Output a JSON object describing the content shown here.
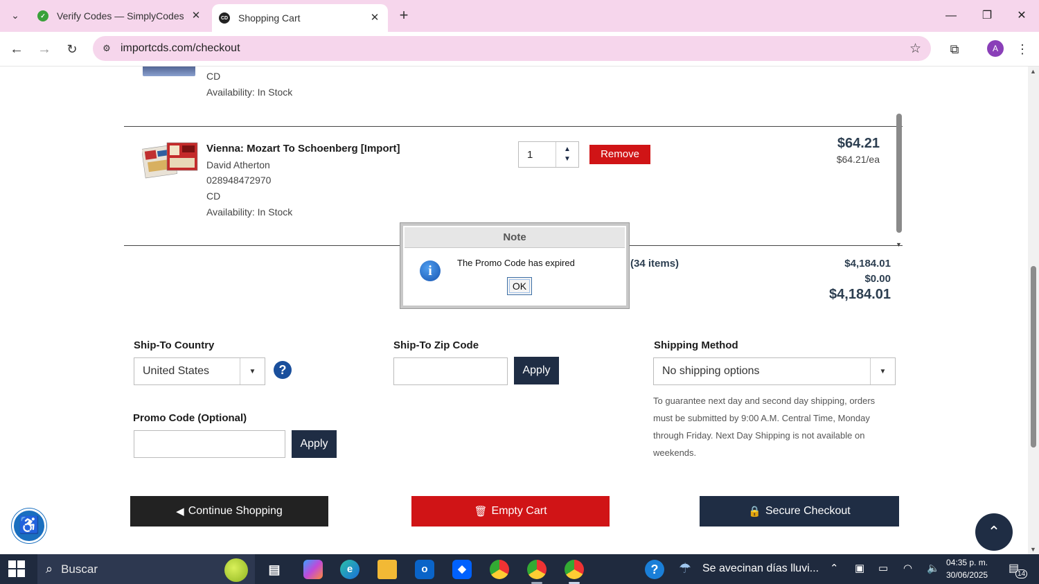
{
  "browser": {
    "tabs": [
      {
        "title": "Verify Codes — SimplyCodes",
        "favicon": "simplycodes-icon",
        "active": false
      },
      {
        "title": "Shopping Cart",
        "favicon": "importcds-icon",
        "favicon_text": "CD",
        "active": true
      }
    ],
    "url": "importcds.com/checkout",
    "profile_initial": "A"
  },
  "cart": {
    "previous_item": {
      "format": "CD",
      "availability": "Availability: In Stock"
    },
    "item": {
      "title": "Vienna: Mozart To Schoenberg [Import]",
      "artist": "David Atherton",
      "upc": "028948472970",
      "format": "CD",
      "availability": "Availability: In Stock",
      "quantity": "1",
      "remove_label": "Remove",
      "price": "$64.21",
      "price_each": "$64.21/ea"
    },
    "totals": {
      "items_label": "(34 items)",
      "subtotal": "$4,184.01",
      "discount": "$0.00",
      "total": "$4,184.01"
    }
  },
  "shipping": {
    "country_label": "Ship-To Country",
    "country_value": "United States",
    "zip_label": "Ship-To Zip Code",
    "zip_value": "",
    "zip_apply": "Apply",
    "method_label": "Shipping Method",
    "method_value": "No shipping options",
    "note": "To guarantee next day and second day shipping, orders must be submitted by 9:00 A.M. Central Time, Monday through Friday. Next Day Shipping is not available on weekends."
  },
  "promo": {
    "label": "Promo Code (Optional)",
    "value": "",
    "apply": "Apply"
  },
  "actions": {
    "continue": "Continue Shopping",
    "empty": "Empty Cart",
    "checkout": "Secure Checkout"
  },
  "dialog": {
    "title": "Note",
    "message": "The Promo Code has expired",
    "ok": "OK"
  },
  "taskbar": {
    "search_placeholder": "Buscar",
    "weather": "Se avecinan días lluvi...",
    "time": "04:35 p. m.",
    "date": "30/06/2025",
    "notifications": "14"
  },
  "colors": {
    "remove_red": "#d01416",
    "navy": "#1f2d44",
    "chrome_pink": "#f6d6ec"
  }
}
